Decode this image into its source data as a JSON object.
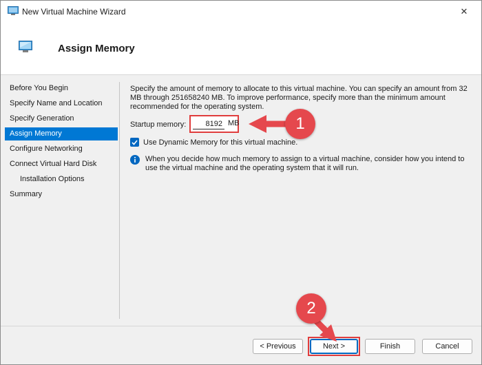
{
  "window": {
    "title": "New Virtual Machine Wizard",
    "close_glyph": "✕"
  },
  "header": {
    "title": "Assign Memory"
  },
  "sidebar": {
    "items": [
      {
        "label": "Before You Begin",
        "active": false
      },
      {
        "label": "Specify Name and Location",
        "active": false
      },
      {
        "label": "Specify Generation",
        "active": false
      },
      {
        "label": "Assign Memory",
        "active": true
      },
      {
        "label": "Configure Networking",
        "active": false
      },
      {
        "label": "Connect Virtual Hard Disk",
        "active": false
      },
      {
        "label": "Installation Options",
        "active": false
      },
      {
        "label": "Summary",
        "active": false
      }
    ]
  },
  "main": {
    "description": "Specify the amount of memory to allocate to this virtual machine. You can specify an amount from 32 MB through 251658240 MB. To improve performance, specify more than the minimum amount recommended for the operating system.",
    "startup_memory_label": "Startup memory:",
    "startup_memory_value": "8192",
    "startup_memory_unit": "MB",
    "dynamic_memory_label": "Use Dynamic Memory for this virtual machine.",
    "dynamic_memory_checked": true,
    "info_text": "When you decide how much memory to assign to a virtual machine, consider how you intend to use the virtual machine and the operating system that it will run."
  },
  "footer": {
    "previous_label": "< Previous",
    "next_label": "Next >",
    "finish_label": "Finish",
    "cancel_label": "Cancel"
  },
  "annotations": {
    "callout_1": "1",
    "callout_2": "2",
    "highlight_color": "#e03c3c",
    "callout_color": "#e5484d"
  },
  "colors": {
    "accent": "#0078d4",
    "checkbox": "#0067c0"
  },
  "icons": {
    "title_icon": "monitor-icon",
    "header_icon": "monitor-icon",
    "info_icon": "info-icon",
    "check_icon": "check-icon",
    "close_icon": "close-icon"
  }
}
